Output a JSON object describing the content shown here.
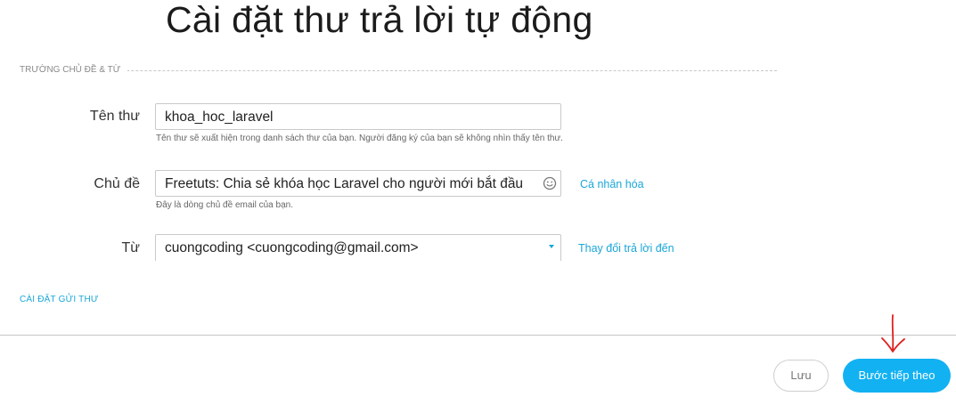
{
  "page": {
    "title": "Cài đặt thư trả lời tự động"
  },
  "section": {
    "fields_heading": "TRƯỜNG CHỦ ĐỀ & TỪ",
    "send_settings": "CÀI ĐẶT GỬI THƯ"
  },
  "fields": {
    "name": {
      "label": "Tên thư",
      "value": "khoa_hoc_laravel",
      "help": "Tên thư sẽ xuất hiện trong danh sách thư của bạn. Người đăng ký của bạn sẽ không nhìn thấy tên thư."
    },
    "subject": {
      "label": "Chủ đề",
      "value": "Freetuts: Chia sẻ khóa học Laravel cho người mới bắt đầu",
      "help": "Đây là dòng chủ đề email của bạn.",
      "personalize_link": "Cá nhân hóa",
      "icon": "emoji-smile-icon"
    },
    "from": {
      "label": "Từ",
      "value": "cuongcoding <cuongcoding@gmail.com>",
      "change_reply_link": "Thay đổi trả lời đến",
      "icon": "caret-down-icon"
    }
  },
  "footer": {
    "save_label": "Lưu",
    "next_label": "Bước tiếp theo"
  },
  "colors": {
    "accent": "#12b1f2",
    "link": "#1aa6d8",
    "annotation": "#e02020"
  }
}
